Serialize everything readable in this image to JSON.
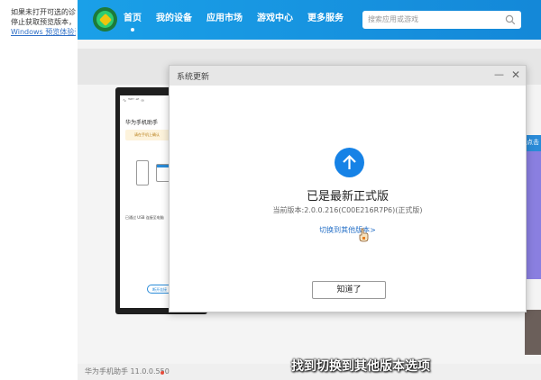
{
  "left_doc": {
    "line1": "如果未打开可选的诊",
    "line2": "停止获取预览版本，",
    "line3": "Windows 预览体验计"
  },
  "nav": {
    "items": [
      "首页",
      "我的设备",
      "应用市场",
      "游戏中心",
      "更多服务"
    ],
    "active_index": 0
  },
  "search": {
    "placeholder": "搜索应用或游戏"
  },
  "phone": {
    "status": "∿ 'ᴺᴱ' ᵃᴱ ∞",
    "title": "华为手机助手",
    "notice": "请在手机上确认",
    "caption": "已通过 USB 连接至电脑",
    "button": "断开连接"
  },
  "right_strip": {
    "label": "点击"
  },
  "dialog": {
    "title": "系统更新",
    "heading": "已是最新正式版",
    "version": "当前版本:2.0.0.216(C00E216R7P6)(正式版)",
    "link": "切换到其他版本>",
    "ok": "知道了",
    "min_icon": "—",
    "close_icon": "✕"
  },
  "footer": {
    "version": "华为手机助手 11.0.0.550"
  },
  "subtitle": "找到切换到其他版本选项",
  "colors": {
    "topbar": "#1aa0e8",
    "accent": "#1682e6",
    "link": "#2a73c8"
  }
}
